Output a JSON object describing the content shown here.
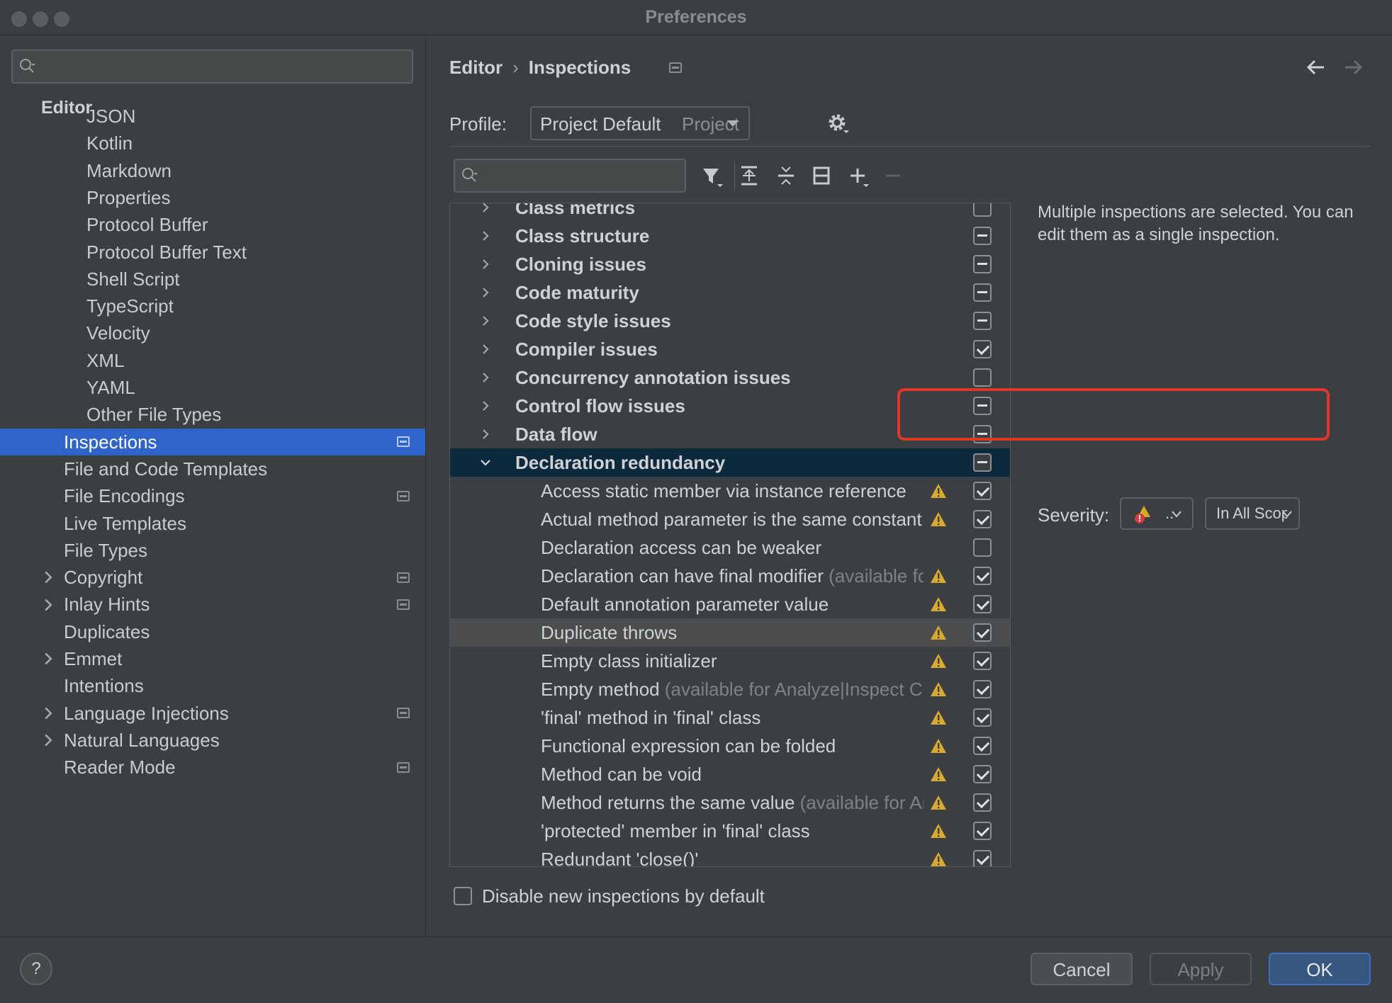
{
  "window": {
    "title": "Preferences"
  },
  "sidebar": {
    "search_placeholder": "",
    "section_title": "Editor",
    "items": [
      {
        "label": "JSON",
        "partial": true
      },
      {
        "label": "Kotlin"
      },
      {
        "label": "Markdown"
      },
      {
        "label": "Properties"
      },
      {
        "label": "Protocol Buffer"
      },
      {
        "label": "Protocol Buffer Text"
      },
      {
        "label": "Shell Script"
      },
      {
        "label": "TypeScript"
      },
      {
        "label": "Velocity"
      },
      {
        "label": "XML"
      },
      {
        "label": "YAML"
      },
      {
        "label": "Other File Types"
      },
      {
        "label": "Inspections",
        "selected": true,
        "project_icon": true
      },
      {
        "label": "File and Code Templates"
      },
      {
        "label": "File Encodings",
        "project_icon": true
      },
      {
        "label": "Live Templates"
      },
      {
        "label": "File Types"
      },
      {
        "label": "Copyright",
        "expandable": true,
        "project_icon": true
      },
      {
        "label": "Inlay Hints",
        "expandable": true,
        "project_icon": true
      },
      {
        "label": "Duplicates"
      },
      {
        "label": "Emmet",
        "expandable": true
      },
      {
        "label": "Intentions"
      },
      {
        "label": "Language Injections",
        "expandable": true,
        "project_icon": true
      },
      {
        "label": "Natural Languages",
        "expandable": true
      },
      {
        "label": "Reader Mode",
        "partial": true,
        "project_icon": true
      }
    ]
  },
  "breadcrumb": {
    "parent": "Editor",
    "separator": "›",
    "current": "Inspections"
  },
  "profile": {
    "label": "Profile:",
    "value": "Project Default",
    "scope": "Project"
  },
  "filter": {
    "search_placeholder": ""
  },
  "toolbar": {
    "icons": [
      "filter-icon",
      "expand-all-icon",
      "collapse-all-icon",
      "reset-icon",
      "add-icon",
      "remove-icon"
    ]
  },
  "tree": {
    "rows": [
      {
        "label": "Class metrics",
        "group": true,
        "state": "unchecked",
        "partial": true
      },
      {
        "label": "Class structure",
        "group": true,
        "state": "mixed"
      },
      {
        "label": "Cloning issues",
        "group": true,
        "state": "mixed"
      },
      {
        "label": "Code maturity",
        "group": true,
        "state": "mixed"
      },
      {
        "label": "Code style issues",
        "group": true,
        "state": "mixed"
      },
      {
        "label": "Compiler issues",
        "group": true,
        "state": "checked"
      },
      {
        "label": "Concurrency annotation issues",
        "group": true,
        "state": "unchecked"
      },
      {
        "label": "Control flow issues",
        "group": true,
        "state": "mixed"
      },
      {
        "label": "Data flow",
        "group": true,
        "state": "mixed"
      },
      {
        "label": "Declaration redundancy",
        "group": true,
        "expanded": true,
        "selected": true,
        "state": "mixed"
      },
      {
        "label": "Access static member via instance reference",
        "state": "checked",
        "warning": true
      },
      {
        "label": "Actual method parameter is the same constant",
        "state": "checked",
        "warning": true
      },
      {
        "label": "Declaration access can be weaker",
        "state": "unchecked",
        "warning": false
      },
      {
        "label": "Declaration can have final modifier",
        "note": "(available for Analyze|Inspect Code)",
        "state": "checked",
        "warning": true
      },
      {
        "label": "Default annotation parameter value",
        "state": "checked",
        "warning": true
      },
      {
        "label": "Duplicate throws",
        "state": "checked",
        "warning": true,
        "hover": true
      },
      {
        "label": "Empty class initializer",
        "state": "checked",
        "warning": true
      },
      {
        "label": "Empty method",
        "note": "(available for Analyze|Inspect Code)",
        "state": "checked",
        "warning": true
      },
      {
        "label": "'final' method in 'final' class",
        "state": "checked",
        "warning": true
      },
      {
        "label": "Functional expression can be folded",
        "state": "checked",
        "warning": true
      },
      {
        "label": "Method can be void",
        "state": "checked",
        "warning": true
      },
      {
        "label": "Method returns the same value",
        "note": "(available for Analyze|Inspect Code)",
        "state": "checked",
        "warning": true
      },
      {
        "label": "'protected' member in 'final' class",
        "state": "checked",
        "warning": true
      },
      {
        "label": "Redundant 'close()'",
        "state": "checked",
        "warning": true,
        "partial": true
      }
    ]
  },
  "description": {
    "text": "Multiple inspections are selected. You can edit them as a single inspection."
  },
  "severity": {
    "label": "Severity:",
    "value": "..",
    "scope": "In All Scopes"
  },
  "options": {
    "disable_new_label": "Disable new inspections by default"
  },
  "footer": {
    "help_label": "?",
    "cancel_label": "Cancel",
    "apply_label": "Apply",
    "ok_label": "OK"
  },
  "colors": {
    "selection_blue": "#2f65ca",
    "tree_selection": "#0d293e",
    "highlight_red": "#e2352c",
    "warning_yellow": "#d9a92b",
    "ok_blue": "#365880"
  }
}
